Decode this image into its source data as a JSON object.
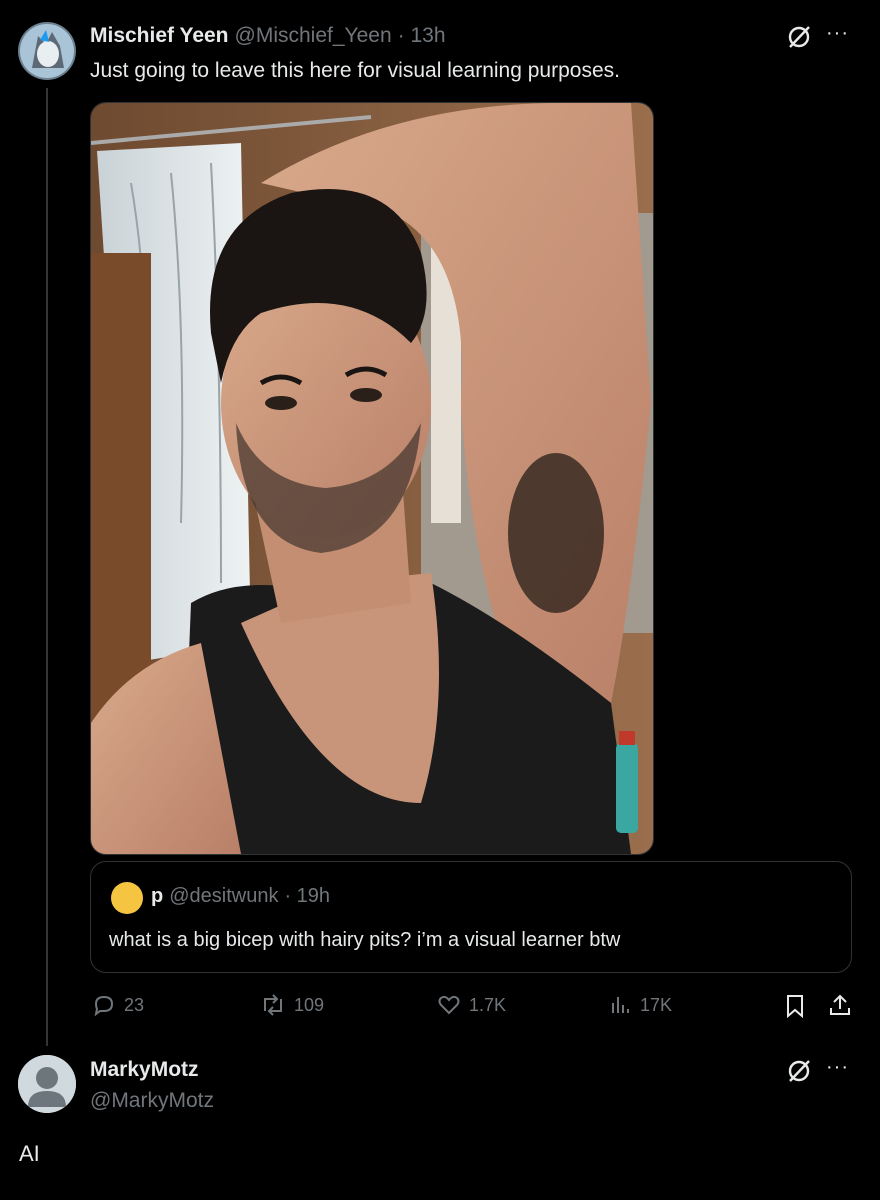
{
  "tweet": {
    "author_name": "Mischief Yeen",
    "handle": "@Mischief_Yeen",
    "time": "· 13h",
    "text": "Just going to leave this here for visual learning purposes.",
    "more": "···"
  },
  "quote": {
    "author_name": "p",
    "handle": "@desitwunk",
    "time": "· 19h",
    "text": "what is a big bicep with hairy pits? i’m a visual learner btw"
  },
  "actions": {
    "replies": "23",
    "reposts": "109",
    "likes": "1.7K",
    "views": "17K"
  },
  "reply": {
    "author_name": "MarkyMotz",
    "handle": "@MarkyMotz",
    "more": "···",
    "text": "AI"
  }
}
